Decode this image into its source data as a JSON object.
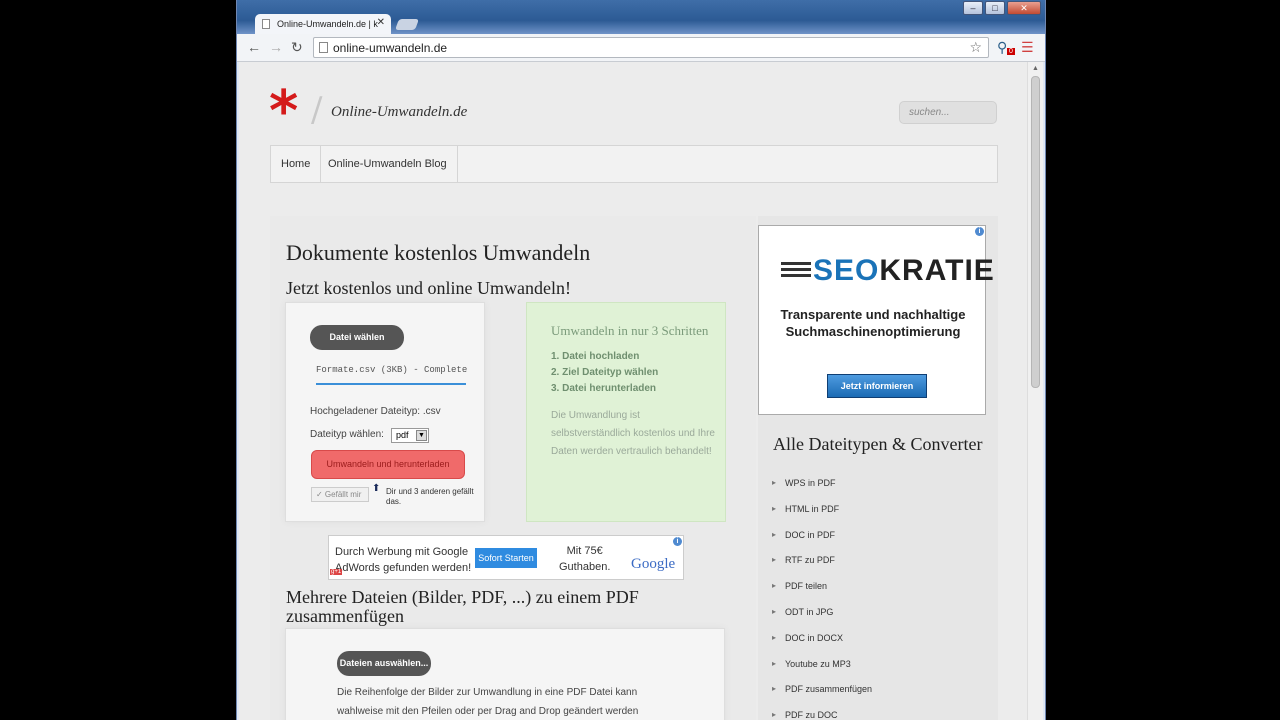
{
  "browser": {
    "tab_title": "Online-Umwandeln.de | k",
    "tab_close": "✕",
    "url": "online-umwandeln.de",
    "win_min": "–",
    "win_max": "□",
    "win_close": "✕",
    "ext_badge": "0"
  },
  "header": {
    "logo_star": "*",
    "logo_slash": "/",
    "logo_text": "Online-Umwandeln.de",
    "search_placeholder": "suchen..."
  },
  "nav": {
    "items": [
      "Home",
      "Online-Umwandeln Blog"
    ]
  },
  "main": {
    "title": "Dokumente kostenlos Umwandeln",
    "subtitle": "Jetzt kostenlos und online Umwandeln!",
    "upload": {
      "choose_label": "Datei wählen",
      "file_status": "Formate.csv (3KB) - Complete",
      "uploaded_type": "Hochgeladener Dateityp: .csv",
      "target_label": "Dateityp wählen:",
      "target_value": "pdf",
      "convert_label": "Umwandeln und herunterladen",
      "like_label": "✓ Gefällt mir",
      "like_text": "Dir und 3 anderen gefällt das."
    },
    "steps": {
      "title": "Umwandeln in nur 3 Schritten",
      "items": [
        "1. Datei hochladen",
        "2. Ziel Dateityp wählen",
        "3. Datei herunterladen"
      ],
      "description": "Die Umwandlung ist selbstverständlich kostenlos und Ihre Daten werden vertraulich behandelt!"
    },
    "ad": {
      "text_line1": "Durch Werbung mit Google",
      "text_line2": "AdWords gefunden werden!",
      "button": "Sofort Starten",
      "offer_line1": "Mit 75€",
      "offer_line2": "Guthaben.",
      "brand": "Google",
      "gplus": "g+1",
      "info": "i"
    },
    "merge": {
      "title": "Mehrere Dateien (Bilder, PDF, ...) zu einem PDF zusammenfügen",
      "button": "Dateien auswählen...",
      "desc_line1": "Die Reihenfolge der Bilder zur Umwandlung in eine PDF Datei kann",
      "desc_line2": "wahlweise mit den Pfeilen oder per Drag and Drop geändert werden"
    }
  },
  "sidebar": {
    "ad": {
      "brand_prefix": "SEO",
      "brand_suffix": "KRATIE",
      "tagline_line1": "Transparente und nachhaltige",
      "tagline_line2": "Suchmaschinenoptimierung",
      "button": "Jetzt informieren",
      "info": "i"
    },
    "title": "Alle Dateitypen & Converter",
    "items": [
      "WPS in PDF",
      "HTML in PDF",
      "DOC in PDF",
      "RTF zu PDF",
      "PDF teilen",
      "ODT in JPG",
      "DOC in DOCX",
      "Youtube zu MP3",
      "PDF zusammenfügen",
      "PDF zu DOC"
    ]
  },
  "colors": {
    "accent_red": "#d41a1a",
    "seo_blue": "#1a73b8",
    "progress_blue": "#3a8fd8"
  }
}
